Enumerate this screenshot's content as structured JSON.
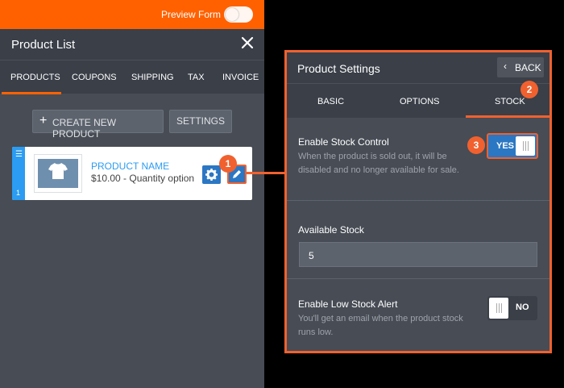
{
  "top_bar": {
    "preview_label": "Preview Form"
  },
  "left_panel": {
    "title": "Product List",
    "tabs": [
      "PRODUCTS",
      "COUPONS",
      "SHIPPING",
      "TAX",
      "INVOICE"
    ],
    "create_button": "CREATE NEW PRODUCT",
    "settings_button": "SETTINGS",
    "product": {
      "name": "PRODUCT NAME",
      "price": "$10.00 - Quantity option",
      "index": "1"
    }
  },
  "right_panel": {
    "title": "Product Settings",
    "back_label": "BACK",
    "tabs": [
      "BASIC",
      "OPTIONS",
      "STOCK"
    ],
    "stock_control": {
      "title": "Enable Stock Control",
      "description": "When the product is sold out, it will be disabled and no longer available for sale.",
      "toggle": "YES"
    },
    "available_stock": {
      "title": "Available Stock",
      "value": "5"
    },
    "low_stock_alert": {
      "title": "Enable Low Stock Alert",
      "description": "You'll get an email when the product stock runs low.",
      "toggle": "NO"
    }
  },
  "badges": [
    "1",
    "2",
    "3"
  ],
  "colors": {
    "accent": "#ff6100",
    "highlight": "#f0612f",
    "primary": "#2b77c3",
    "panel": "#474c55"
  }
}
